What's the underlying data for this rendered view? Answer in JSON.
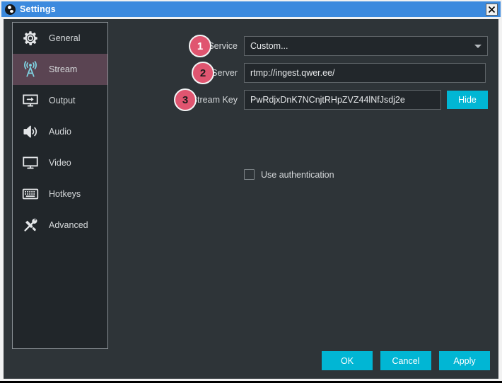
{
  "window": {
    "title": "Settings",
    "logo_icon": "obs-logo-icon",
    "close_icon": "close-icon",
    "titlebar_color": "#3c8ade",
    "body_color": "#2e3438"
  },
  "sidebar": {
    "items": [
      {
        "label": "General",
        "icon": "gear-icon",
        "active": false
      },
      {
        "label": "Stream",
        "icon": "broadcast-icon",
        "active": true
      },
      {
        "label": "Output",
        "icon": "monitor-arrow-icon",
        "active": false
      },
      {
        "label": "Audio",
        "icon": "speaker-icon",
        "active": false
      },
      {
        "label": "Video",
        "icon": "monitor-icon",
        "active": false
      },
      {
        "label": "Hotkeys",
        "icon": "keyboard-icon",
        "active": false
      },
      {
        "label": "Advanced",
        "icon": "tools-icon",
        "active": false
      }
    ],
    "active_color": "#5a4452",
    "active_icon_color": "#7fd4e3"
  },
  "form": {
    "service": {
      "label": "Service",
      "value": "Custom...",
      "caret_icon": "chevron-down-icon"
    },
    "server": {
      "label": "Server",
      "value": "rtmp://ingest.qwer.ee/",
      "placeholder": ""
    },
    "stream_key": {
      "label": "Stream Key",
      "value": "PwRdjxDnK7NCnjtRHpZVZ44lNfJsdj2e",
      "placeholder": "",
      "hide_button": "Hide"
    },
    "use_authentication": {
      "label": "Use authentication",
      "checked": false
    }
  },
  "callouts": {
    "badge_color": "#e05570",
    "items": [
      {
        "number": "1",
        "target": "service"
      },
      {
        "number": "2",
        "target": "server"
      },
      {
        "number": "3",
        "target": "stream-key"
      }
    ]
  },
  "footer": {
    "ok": "OK",
    "cancel": "Cancel",
    "apply": "Apply",
    "button_color": "#01b6d4"
  }
}
